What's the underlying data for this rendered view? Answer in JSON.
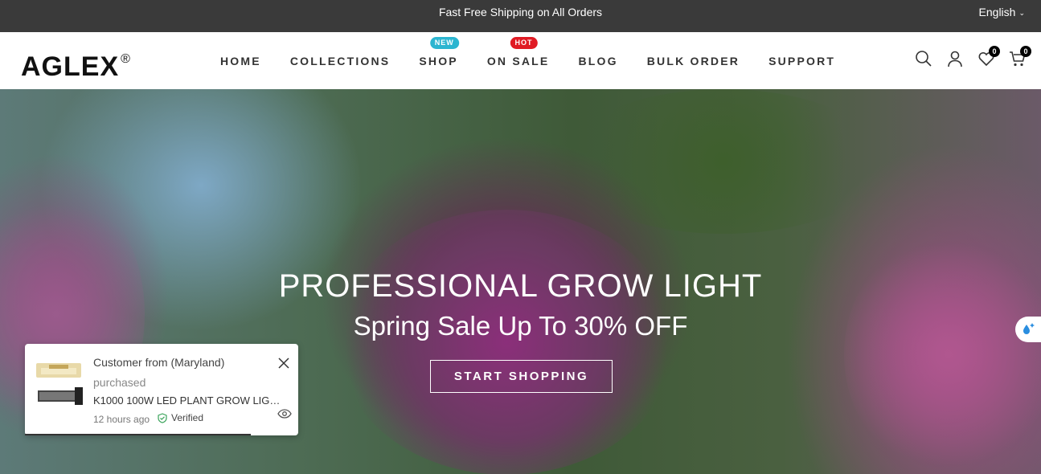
{
  "topbar": {
    "shipping": "Fast Free Shipping on All Orders",
    "language": "English"
  },
  "brand": {
    "logo": "AGLEX",
    "mark": "®"
  },
  "nav": {
    "items": [
      {
        "label": "HOME"
      },
      {
        "label": "COLLECTIONS"
      },
      {
        "label": "SHOP",
        "badge": "NEW"
      },
      {
        "label": "ON SALE",
        "badge": "HOT"
      },
      {
        "label": "BLOG"
      },
      {
        "label": "BULK ORDER"
      },
      {
        "label": "SUPPORT"
      }
    ]
  },
  "header_icons": {
    "wishlist_count": "0",
    "cart_count": "0"
  },
  "hero": {
    "title": "PROFESSIONAL GROW LIGHT",
    "subtitle": "Spring Sale Up To 30% OFF",
    "cta": "START SHOPPING"
  },
  "popup": {
    "customer": "Customer from (Maryland)",
    "action": "purchased",
    "product": "K1000 100W LED PLANT GROW LIGHT",
    "time": "12 hours ago",
    "verified": "Verified"
  },
  "colors": {
    "topbar": "#3a3a3a",
    "badge_new": "#2bb5d0",
    "badge_hot": "#e01b24",
    "nav_text": "#333333"
  }
}
